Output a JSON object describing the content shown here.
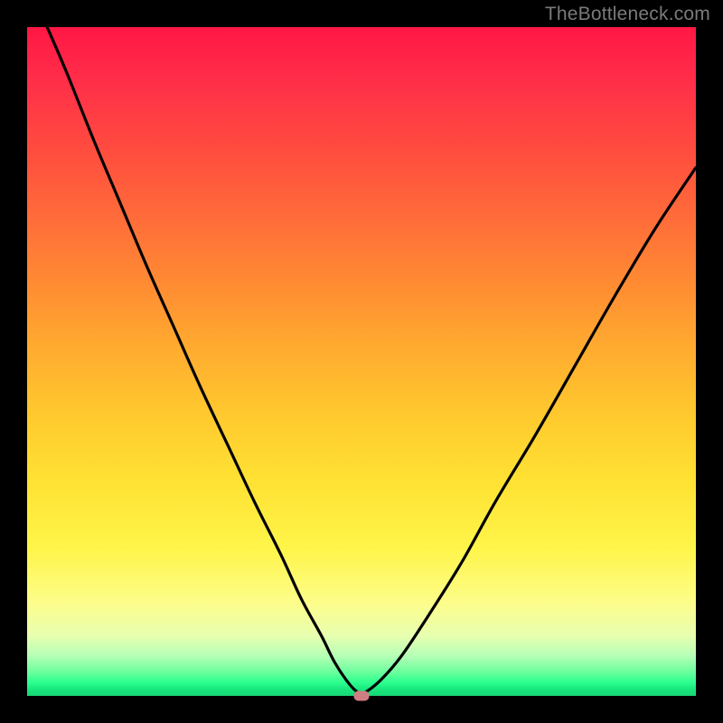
{
  "watermark": "TheBottleneck.com",
  "chart_data": {
    "type": "line",
    "title": "",
    "xlabel": "",
    "ylabel": "",
    "xlim": [
      0,
      100
    ],
    "ylim": [
      0,
      100
    ],
    "grid": false,
    "legend": false,
    "background_gradient": {
      "top": "#ff1744",
      "mid": "#ffe233",
      "bottom": "#19e77d"
    },
    "series": [
      {
        "name": "bottleneck-curve",
        "color": "#000000",
        "x": [
          3,
          6,
          10,
          14,
          18,
          22,
          26,
          30,
          34,
          38,
          41,
          44,
          46,
          48,
          49.5,
          50.5,
          53,
          56,
          60,
          65,
          70,
          76,
          82,
          88,
          94,
          100
        ],
        "y": [
          100,
          93,
          83,
          73.5,
          64,
          55,
          46,
          37.5,
          29,
          21,
          14.5,
          9,
          5,
          2,
          0.5,
          0.5,
          2.5,
          6,
          12,
          20,
          29,
          39,
          49.5,
          60,
          70,
          79
        ]
      }
    ],
    "marker": {
      "name": "optimal-point",
      "x": 50,
      "y": 0,
      "color": "#cf7d82"
    }
  }
}
